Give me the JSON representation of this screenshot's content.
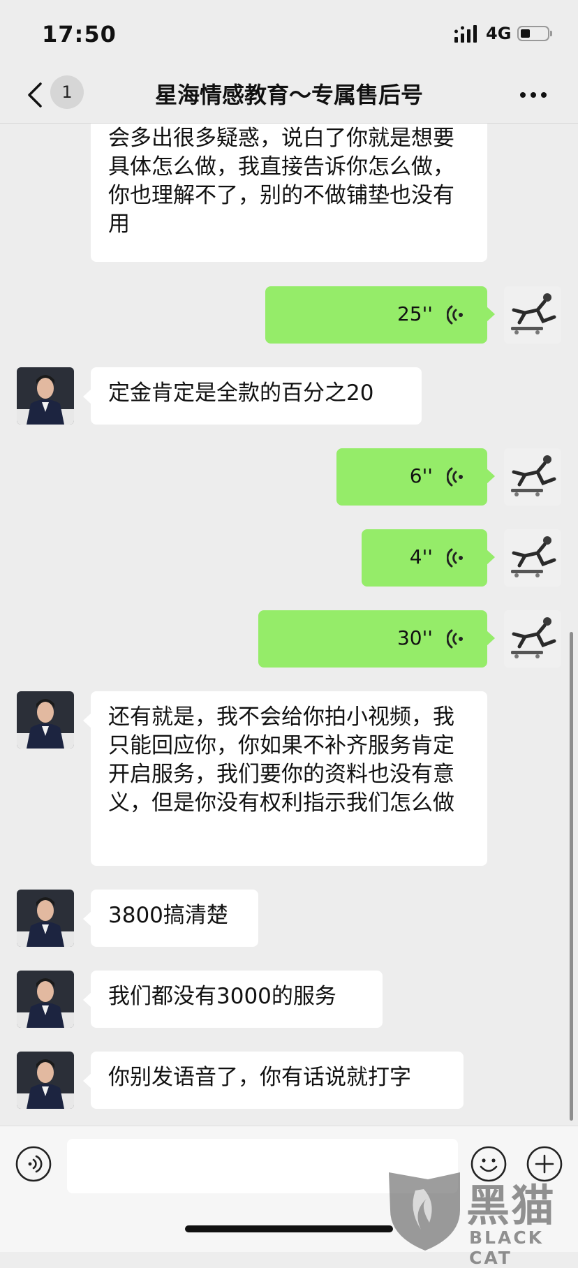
{
  "status_bar": {
    "time": "17:50",
    "network": "4G",
    "battery_level": 0.35
  },
  "nav": {
    "back_badge": "1",
    "title": "星海情感教育～专属售后号"
  },
  "messages": [
    {
      "from": "other",
      "type": "text",
      "text": "你已经解不了它那的一会方案，没而会多出很多疑惑，说白了你就是想要具体怎么做，我直接告诉你怎么做，你也理解不了，别的不做铺垫也没有用"
    },
    {
      "from": "me",
      "type": "voice",
      "duration": "25''"
    },
    {
      "from": "other",
      "type": "text",
      "text": "定金肯定是全款的百分之20"
    },
    {
      "from": "me",
      "type": "voice",
      "duration": "6''"
    },
    {
      "from": "me",
      "type": "voice",
      "duration": "4''"
    },
    {
      "from": "me",
      "type": "voice",
      "duration": "30''"
    },
    {
      "from": "other",
      "type": "text",
      "text": "还有就是，我不会给你拍小视频，我只能回应你，你如果不补齐服务肯定开启服务，我们要你的资料也没有意义，但是你没有权利指示我们怎么做"
    },
    {
      "from": "other",
      "type": "text",
      "text": "3800搞清楚"
    },
    {
      "from": "other",
      "type": "text",
      "text": "我们都没有3000的服务"
    },
    {
      "from": "other",
      "type": "text",
      "text": "你别发语音了，你有话说就打字"
    }
  ],
  "input": {
    "placeholder": ""
  },
  "watermark": {
    "cn": "黑猫",
    "en": "BLACK CAT"
  },
  "colors": {
    "background": "#ededed",
    "my_bubble": "#95ec69",
    "other_bubble": "#ffffff",
    "icon": "#222222"
  }
}
